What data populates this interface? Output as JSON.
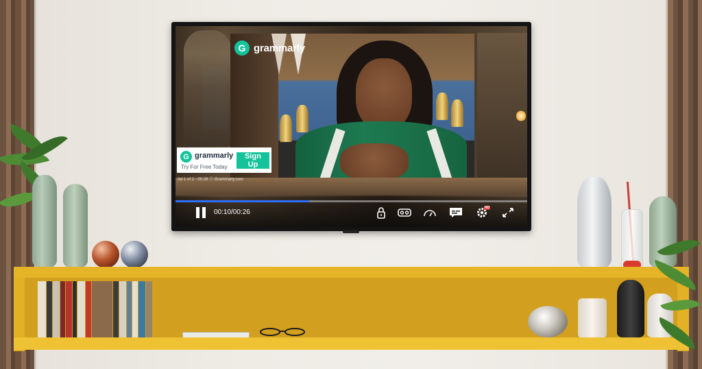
{
  "brand": {
    "name": "grammarly",
    "logo_letter": "G",
    "accent": "#15c39a"
  },
  "ad": {
    "brand_name": "grammarly",
    "tagline": "Try For Free Today",
    "cta_label": "Sign Up",
    "info": "Ad 1 of 2 · 00:26 ⓘ Grammarly.com"
  },
  "player": {
    "time": "00:10/00:26",
    "progress_fraction": 0.38,
    "progress_color": "#2e6fff",
    "controls": [
      "lock-icon",
      "vr-headset-icon",
      "speedometer-icon",
      "subtitles-icon",
      "settings-icon",
      "fullscreen-icon"
    ],
    "quality_badge": "HD"
  }
}
